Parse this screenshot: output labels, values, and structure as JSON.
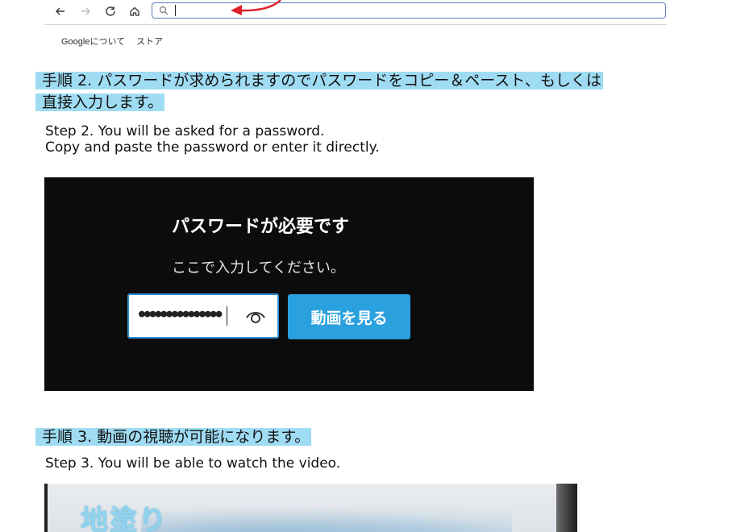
{
  "browser": {
    "nav_icons": [
      "back-arrow-icon",
      "forward-arrow-icon",
      "reload-icon",
      "home-icon"
    ],
    "address_search_icon": "search-icon",
    "links": [
      "Googleについて",
      "ストア"
    ]
  },
  "step2": {
    "jp_line1": "手順 2. パスワードが求められますのでパスワードをコピー＆ペースト、もしくは",
    "jp_line2": "直接入力します。",
    "en_line1": "Step 2. You will be asked for a password.",
    "en_line2": "Copy and paste the password or enter it directly."
  },
  "password_panel": {
    "title": "パスワードが必要です",
    "subtitle": "ここで入力してください。",
    "masked_value": "●●●●●●●●●●●●●●●",
    "button_label": "動画を見る",
    "accent_color": "#2aa0de"
  },
  "step3": {
    "jp": "手順 3. 動画の視聴が可能になります。",
    "en": "Step 3. You will be able to watch the video."
  },
  "video": {
    "caption": "地塗り"
  },
  "colors": {
    "highlight": "#9fdcf3",
    "arrow": "#e0202a"
  }
}
